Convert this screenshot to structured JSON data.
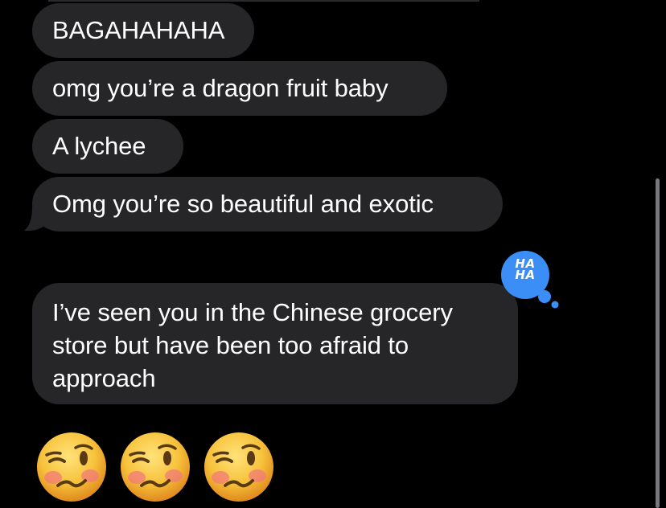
{
  "messages": [
    {
      "text": "BAGAHAHAHA"
    },
    {
      "text": "omg you’re a dragon fruit baby"
    },
    {
      "text": "A lychee"
    },
    {
      "text": "Omg you’re so beautiful and exotic"
    },
    {
      "text": "I’ve seen you in the Chinese grocery store but have been too afraid to approach"
    }
  ],
  "tapback": {
    "label": "HA HA",
    "icon": "haha-tapback-icon",
    "color": "#3a8ef6"
  },
  "emoji_message": {
    "icons": [
      "woozy-face-icon",
      "woozy-face-icon",
      "woozy-face-icon"
    ],
    "count": 3
  },
  "colors": {
    "background": "#000000",
    "incoming_bubble": "#262628",
    "text": "#ffffff"
  }
}
